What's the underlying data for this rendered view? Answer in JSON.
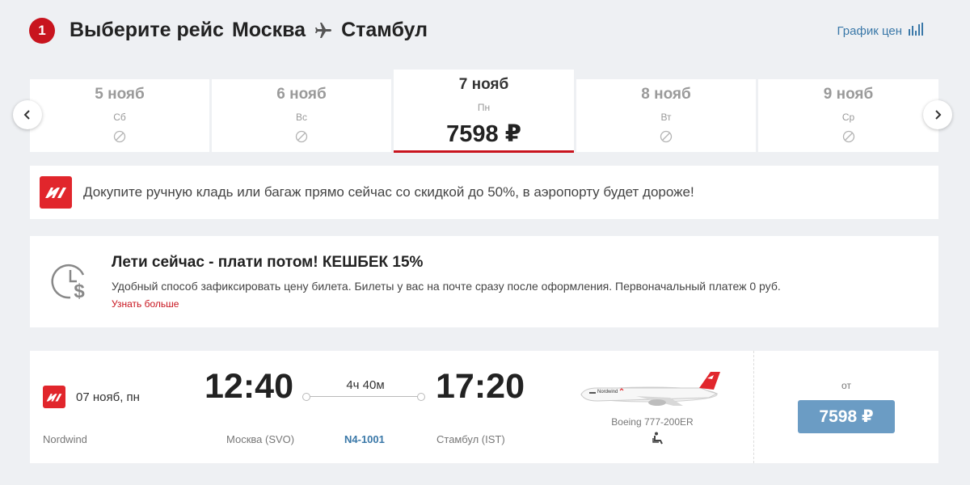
{
  "header": {
    "step_number": "1",
    "title_prefix": "Выберите рейс",
    "origin": "Москва",
    "destination": "Стамбул",
    "price_chart_label": "График цен"
  },
  "dates": [
    {
      "date": "5 нояб",
      "weekday": "Сб",
      "available": false
    },
    {
      "date": "6 нояб",
      "weekday": "Вс",
      "available": false
    },
    {
      "date": "7 нояб",
      "weekday": "Пн",
      "available": true,
      "price": "7598 ₽",
      "selected": true
    },
    {
      "date": "8 нояб",
      "weekday": "Вт",
      "available": false
    },
    {
      "date": "9 нояб",
      "weekday": "Ср",
      "available": false
    }
  ],
  "promo": {
    "text": "Докупите ручную кладь или багаж прямо сейчас со скидкой до 50%, в аэропорту будет дороже!"
  },
  "cashback": {
    "title": "Лети сейчас - плати потом! КЕШБЕК 15%",
    "description": "Удобный способ зафиксировать цену билета. Билеты у вас на почте сразу после оформления. Первоначальный платеж 0 руб.",
    "link_label": "Узнать больше"
  },
  "flight": {
    "date": "07 нояб, пн",
    "carrier": "Nordwind",
    "departure_time": "12:40",
    "arrival_time": "17:20",
    "duration": "4ч 40м",
    "departure_airport": "Москва (SVO)",
    "arrival_airport": "Стамбул (IST)",
    "flight_number": "N4-1001",
    "aircraft": "Boeing 777-200ER",
    "price_prefix": "от",
    "price": "7598 ₽"
  },
  "colors": {
    "brand_red": "#c8141e",
    "nordwind_red": "#e1262c",
    "link_blue": "#3a78a8",
    "price_button": "#6b9cc4",
    "background": "#eef0f3"
  }
}
